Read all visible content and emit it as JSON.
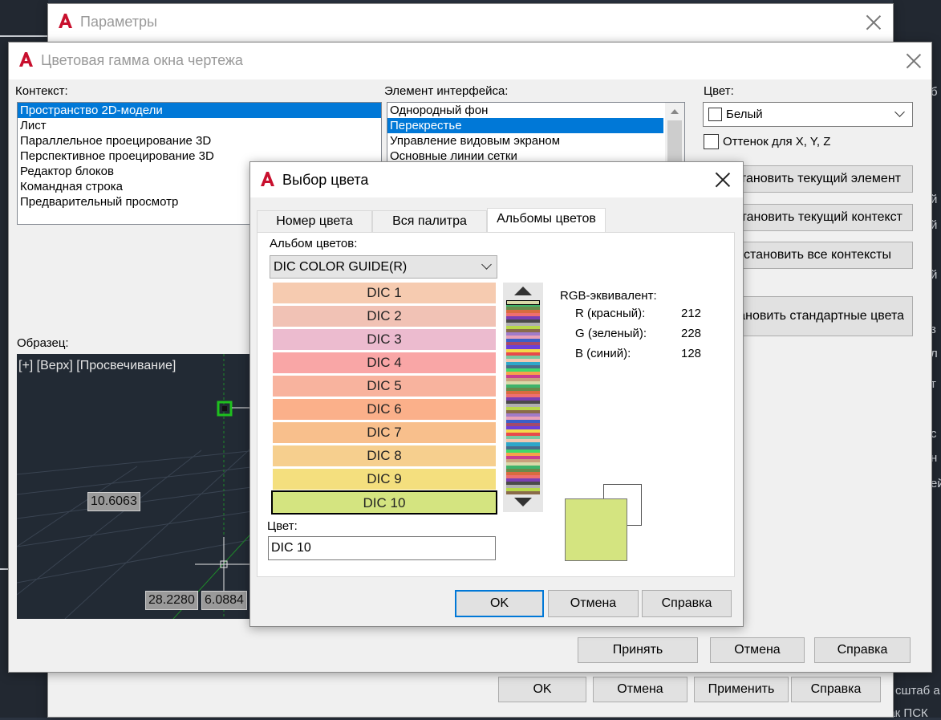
{
  "colors": {
    "background_app": "#2b3340",
    "selection": "#0078d7",
    "swatch_selected": "#d4e480",
    "preview_bg": "#222a34"
  },
  "background_app": {
    "right_texts": [
      "б",
      "з",
      "л",
      "т",
      "с",
      "н",
      "ей",
      "й",
      "й",
      "й"
    ],
    "bottom_texts": [
      "сштаб а",
      "Знак ПСК"
    ]
  },
  "params_window": {
    "title": "Параметры",
    "logo_icon": "autocad-logo-icon",
    "buttons": {
      "ok": "OK",
      "cancel": "Отмена",
      "apply": "Применить",
      "help": "Справка"
    }
  },
  "colorscheme_window": {
    "title": "Цветовая гамма окна чертежа",
    "context_label": "Контекст:",
    "contexts": [
      {
        "label": "Пространство 2D-модели",
        "selected": true
      },
      {
        "label": "Лист",
        "selected": false
      },
      {
        "label": "Параллельное проецирование 3D",
        "selected": false
      },
      {
        "label": "Перспективное проецирование 3D",
        "selected": false
      },
      {
        "label": "Редактор блоков",
        "selected": false
      },
      {
        "label": "Командная строка",
        "selected": false
      },
      {
        "label": "Предварительный просмотр",
        "selected": false
      }
    ],
    "element_label": "Элемент интерфейса:",
    "elements": [
      {
        "label": "Однородный фон",
        "selected": false
      },
      {
        "label": "Перекрестье",
        "selected": true
      },
      {
        "label": "Управление видовым экраном",
        "selected": false
      },
      {
        "label": "Основные линии сетки",
        "selected": false
      }
    ],
    "color_label": "Цвет:",
    "color_value": "Белый",
    "tint_checkbox": "Оттенок для X, Y, Z",
    "action_buttons": [
      "становить текущий элемент",
      "тановить текущий контекст",
      "становить все контексты",
      "тановить стандартные цвета"
    ],
    "sample_label": "Образец:",
    "preview": {
      "viewport_label": "[+] [Верх] [Просвечивание]",
      "coord_1": "10.6063",
      "coord_2": "28.2280",
      "coord_3": "6.0884"
    },
    "buttons": {
      "accept": "Принять",
      "cancel": "Отмена",
      "help": "Справка"
    }
  },
  "select_color_dialog": {
    "title": "Выбор цвета",
    "tabs": [
      {
        "label": "Номер цвета",
        "active": false
      },
      {
        "label": "Вся палитра",
        "active": false
      },
      {
        "label": "Альбомы цветов",
        "active": true
      }
    ],
    "album_label": "Альбом цветов:",
    "album_value": "DIC COLOR GUIDE(R)",
    "swatches": [
      {
        "label": "DIC 1",
        "color": "#f6cbb0",
        "selected": false
      },
      {
        "label": "DIC 2",
        "color": "#f1c2b5",
        "selected": false
      },
      {
        "label": "DIC 3",
        "color": "#ecbbcf",
        "selected": false
      },
      {
        "label": "DIC 4",
        "color": "#f9a6a6",
        "selected": false
      },
      {
        "label": "DIC 5",
        "color": "#f8b39e",
        "selected": false
      },
      {
        "label": "DIC 6",
        "color": "#fbb08a",
        "selected": false
      },
      {
        "label": "DIC 7",
        "color": "#f8bf8c",
        "selected": false
      },
      {
        "label": "DIC 8",
        "color": "#f6cf8e",
        "selected": false
      },
      {
        "label": "DIC 9",
        "color": "#f4df7e",
        "selected": false
      },
      {
        "label": "DIC 10",
        "color": "#d4e480",
        "selected": true
      }
    ],
    "rgb_label": "RGB-эквивалент:",
    "rgb": {
      "r_label": "R (красный):",
      "r_value": "212",
      "g_label": "G (зеленый):",
      "g_value": "228",
      "b_label": "B (синий):",
      "b_value": "128"
    },
    "color_label": "Цвет:",
    "color_value": "DIC 10",
    "buttons": {
      "ok": "OK",
      "cancel": "Отмена",
      "help": "Справка"
    }
  }
}
